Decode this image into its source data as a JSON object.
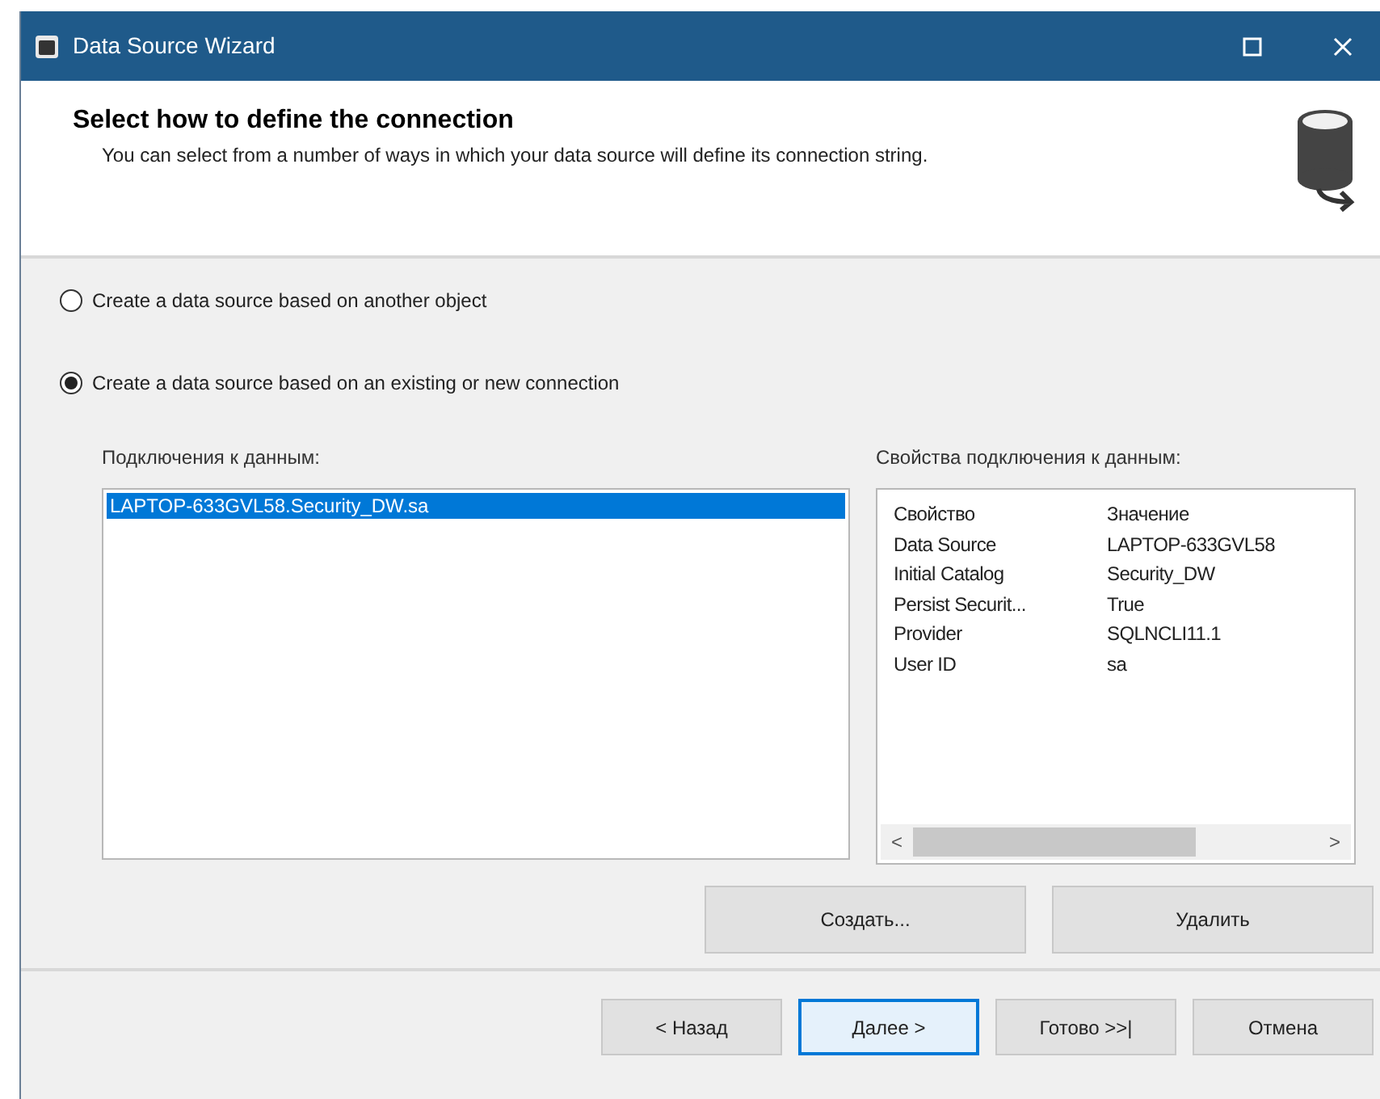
{
  "window": {
    "title": "Data Source Wizard"
  },
  "header": {
    "title": "Select how to define the connection",
    "description": "You can select from a number of ways in which your data source will define its connection string."
  },
  "options": [
    {
      "label": "Create a data source based on another object",
      "selected": false
    },
    {
      "label": "Create a data source based on an existing or new connection",
      "selected": true
    }
  ],
  "connections": {
    "label": "Подключения к данным:",
    "items": [
      {
        "label": "LAPTOP-633GVL58.Security_DW.sa",
        "selected": true
      }
    ]
  },
  "properties": {
    "label": "Свойства подключения к данным:",
    "columns": [
      "Свойство",
      "Значение"
    ],
    "rows": [
      [
        "Data Source",
        "LAPTOP-633GVL58"
      ],
      [
        "Initial Catalog",
        "Security_DW"
      ],
      [
        "Persist Securit...",
        "True"
      ],
      [
        "Provider",
        "SQLNCLI11.1"
      ],
      [
        "User ID",
        "sa"
      ]
    ],
    "scroll_left": "<",
    "scroll_right": ">"
  },
  "connection_buttons": [
    "Создать...",
    "Удалить"
  ],
  "nav_buttons": [
    {
      "label": "< Назад",
      "default": false
    },
    {
      "label": "Далее >",
      "default": true
    },
    {
      "label": "Готово >>|",
      "default": false
    },
    {
      "label": "Отмена",
      "default": false
    }
  ]
}
